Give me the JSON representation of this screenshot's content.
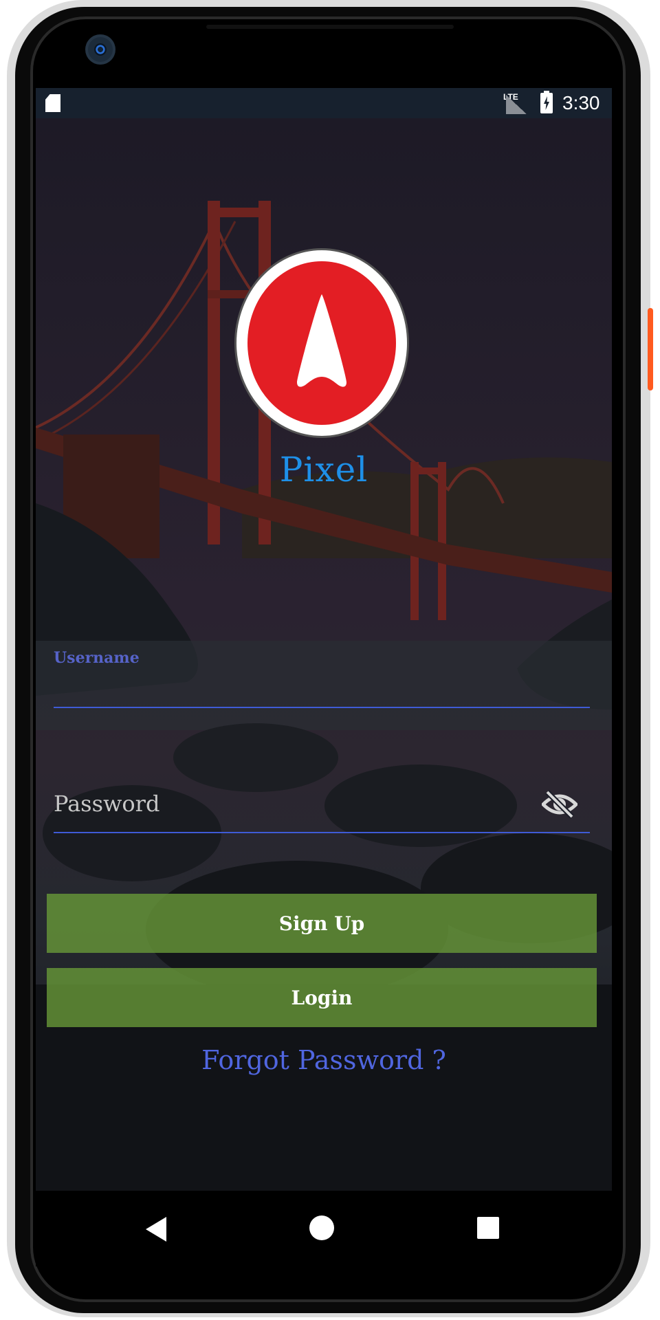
{
  "status_bar": {
    "network_label": "LTE",
    "time": "3:30",
    "icons": [
      "sd-card-icon",
      "signal-icon",
      "battery-charging-icon"
    ]
  },
  "app": {
    "name": "Pixel",
    "logo_icon": "navigation-arrow-icon",
    "brand_color": "#e31e24",
    "title_color": "#1e90e8"
  },
  "form": {
    "username_label": "Username",
    "username_value": "",
    "password_placeholder": "Password",
    "password_value": "",
    "password_toggle_icon": "eye-off-icon"
  },
  "buttons": {
    "signup_label": "Sign Up",
    "login_label": "Login",
    "button_color": "#689838"
  },
  "links": {
    "forgot_password": "Forgot Password ?"
  },
  "nav_bar": {
    "icons": [
      "back-icon",
      "home-icon",
      "recents-icon"
    ]
  }
}
